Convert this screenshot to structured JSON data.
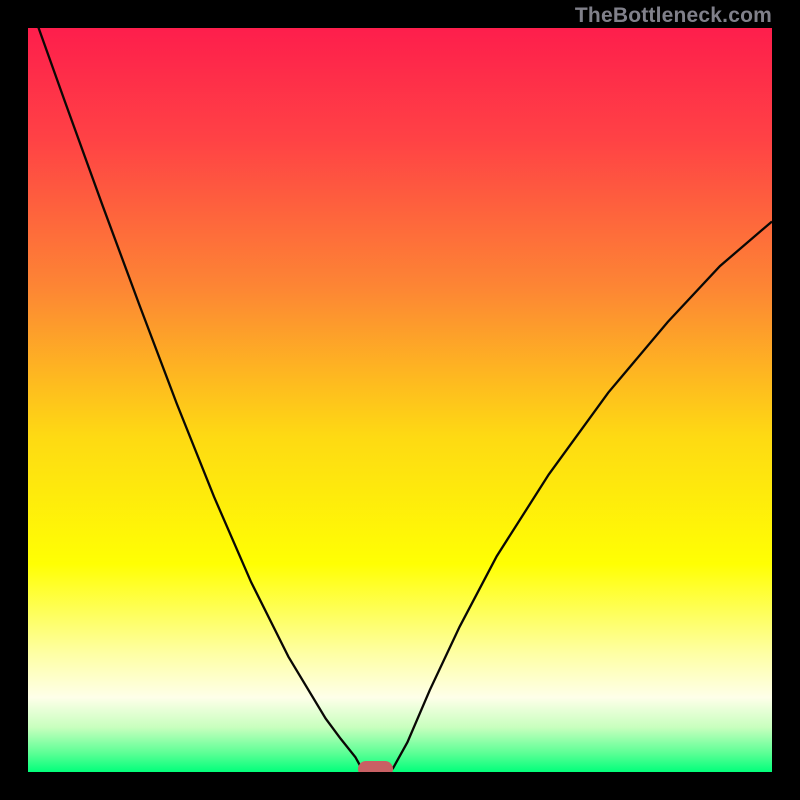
{
  "watermark": "TheBottleneck.com",
  "chart_data": {
    "type": "line",
    "title": "",
    "xlabel": "",
    "ylabel": "",
    "xlim": [
      0,
      1
    ],
    "ylim": [
      0,
      1
    ],
    "legend": false,
    "grid": false,
    "gradient_stops": [
      {
        "offset": 0.0,
        "color": "#fe1e4c"
      },
      {
        "offset": 0.15,
        "color": "#ff4245"
      },
      {
        "offset": 0.35,
        "color": "#fd8634"
      },
      {
        "offset": 0.55,
        "color": "#feda13"
      },
      {
        "offset": 0.72,
        "color": "#ffff03"
      },
      {
        "offset": 0.84,
        "color": "#feffa3"
      },
      {
        "offset": 0.9,
        "color": "#feffe9"
      },
      {
        "offset": 0.94,
        "color": "#c8ffbe"
      },
      {
        "offset": 0.975,
        "color": "#5bff95"
      },
      {
        "offset": 1.0,
        "color": "#02ff7b"
      }
    ],
    "series": [
      {
        "name": "left-curve",
        "x": [
          0.0,
          0.05,
          0.1,
          0.15,
          0.2,
          0.25,
          0.3,
          0.35,
          0.4,
          0.42,
          0.44,
          0.45
        ],
        "y": [
          1.04,
          0.9,
          0.762,
          0.627,
          0.495,
          0.37,
          0.255,
          0.155,
          0.072,
          0.045,
          0.02,
          0.002
        ]
      },
      {
        "name": "right-curve",
        "x": [
          0.49,
          0.51,
          0.54,
          0.58,
          0.63,
          0.7,
          0.78,
          0.86,
          0.93,
          1.0
        ],
        "y": [
          0.004,
          0.04,
          0.11,
          0.195,
          0.29,
          0.4,
          0.51,
          0.605,
          0.68,
          0.74
        ]
      }
    ],
    "marker": {
      "name": "bottleneck-marker",
      "x_center": 0.467,
      "y_center": 0.004,
      "width": 0.047,
      "height": 0.022,
      "color": "#c96064"
    }
  }
}
